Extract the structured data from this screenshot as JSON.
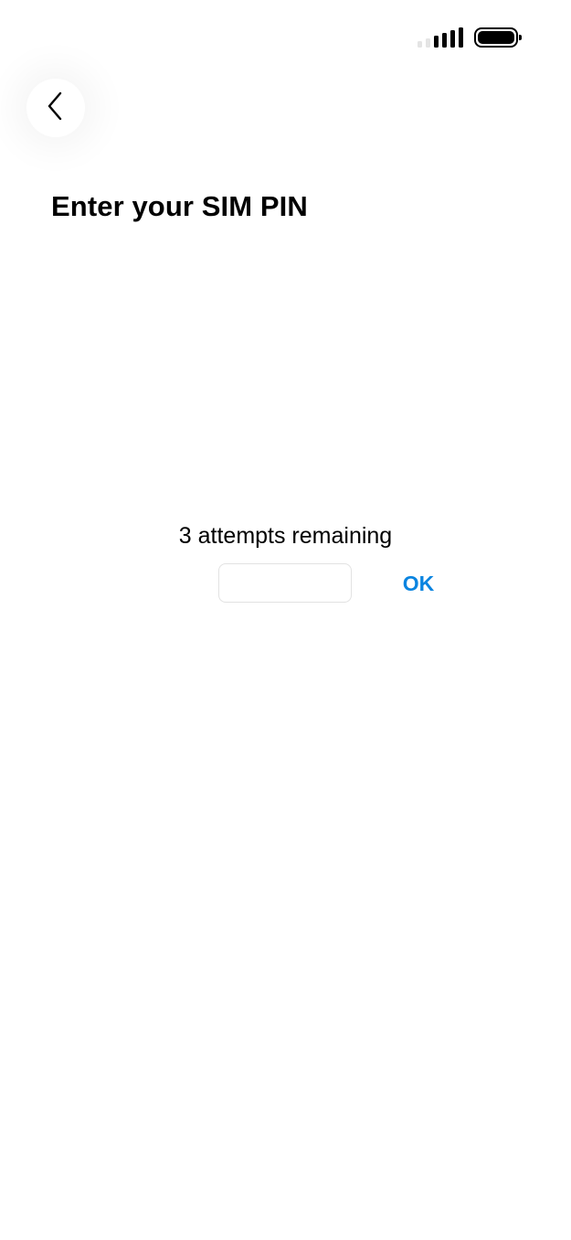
{
  "status_bar": {
    "signal_icon": "cellular-signal-icon",
    "battery_icon": "battery-full-icon"
  },
  "nav": {
    "back_icon": "chevron-left-icon"
  },
  "page": {
    "title": "Enter your SIM PIN"
  },
  "pin": {
    "attempts_text": "3 attempts remaining",
    "input_value": "",
    "input_placeholder": "",
    "ok_label": "OK"
  },
  "colors": {
    "accent": "#0a84e0",
    "text": "#000000",
    "signal_dim": "#e4e4e4",
    "input_border": "#e2e2e2"
  }
}
